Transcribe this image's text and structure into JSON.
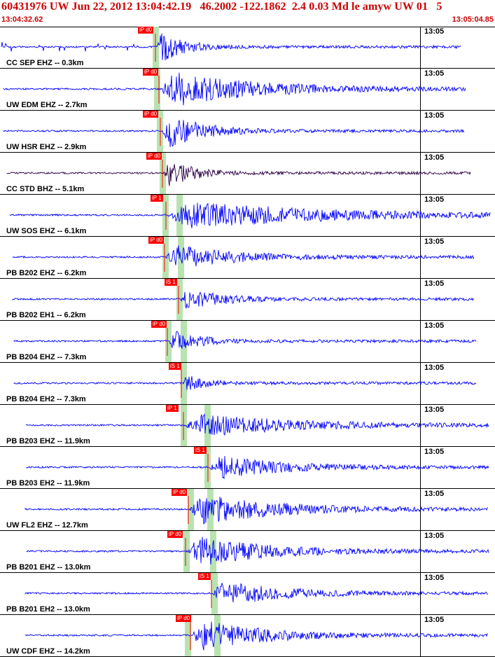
{
  "header": {
    "title": "60431976 UW Jun 22, 2012 13:04:42.19   46.2002 -122.1862  2.4 0.03 Md le amyw UW 01   5",
    "start_time": "13:04:32.62",
    "end_time": "13:05:04.85"
  },
  "minute_label": "13:05",
  "colors": {
    "trace": "#0000ff",
    "pick": "#ff0000",
    "band": "#b8e3b0",
    "title": "#cc0000"
  },
  "panels": [
    {
      "label": "CC SEP EHZ -- 0.3km",
      "pick": "iP d0",
      "trace_color": "#0000ff"
    },
    {
      "label": "UW EDM EHZ -- 2.7km",
      "pick": "iP d0",
      "trace_color": "#0000ff"
    },
    {
      "label": "UW HSR EHZ -- 2.9km",
      "pick": "iP d0",
      "trace_color": "#0000ff"
    },
    {
      "label": "CC STD BHZ -- 5.1km",
      "pick": "iP d0",
      "trace_color": "#2a0044"
    },
    {
      "label": "UW SOS EHZ -- 6.1km",
      "pick": "iP 1",
      "trace_color": "#0000ff"
    },
    {
      "label": "PB B202 EHZ -- 6.2km",
      "pick": "iP d0",
      "trace_color": "#0000ff"
    },
    {
      "label": "PB B202 EH1 -- 6.2km",
      "pick": "iS 1",
      "trace_color": "#0000ff"
    },
    {
      "label": "PB B204 EHZ -- 7.3km",
      "pick": "iP d0",
      "trace_color": "#0000ff"
    },
    {
      "label": "PB B204 EH2 -- 7.3km",
      "pick": "iS 1",
      "trace_color": "#0000ff"
    },
    {
      "label": "PB B203 EHZ -- 11.9km",
      "pick": "iP 1",
      "trace_color": "#0000ff"
    },
    {
      "label": "PB B203 EH2 -- 11.9km",
      "pick": "iS 1",
      "trace_color": "#0000ff"
    },
    {
      "label": "UW FL2 EHZ -- 12.7km",
      "pick": "iP d0",
      "trace_color": "#0000ff"
    },
    {
      "label": "PB B201 EHZ -- 13.0km",
      "pick": "iP d0",
      "trace_color": "#0000ff"
    },
    {
      "label": "PB B201 EH2 -- 13.0km",
      "pick": "iS 1",
      "trace_color": "#0000ff"
    },
    {
      "label": "UW CDF EHZ -- 14.2km",
      "pick": "iP d0",
      "trace_color": "#0000ff"
    }
  ]
}
